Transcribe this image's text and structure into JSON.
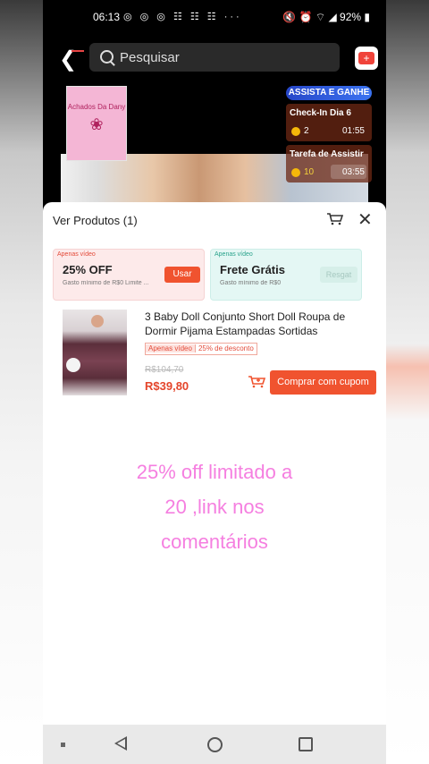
{
  "status_bar": {
    "time": "06:13",
    "notif_icons": "◎ ◎ ◎ ☷ ☷ ☷ ···",
    "right": "🔇 ⏰ ⌔ ◢ 92% ▮"
  },
  "search": {
    "placeholder": "Pesquisar"
  },
  "overlay": {
    "achados_label": "Achados Da Dany",
    "assista_label": "ASSISTA E GANHE",
    "checkin": {
      "label": "Check-In Dia 6",
      "coins": "2",
      "timer": "01:55"
    },
    "tarefa": {
      "label": "Tarefa de Assistir",
      "coins": "10",
      "timer": "03:55"
    }
  },
  "sheet": {
    "title": "Ver Produtos (1)",
    "coupons": [
      {
        "tag": "Apenas vídeo",
        "title": "25% OFF",
        "desc": "Gasto mínimo de R$0 Limite ...",
        "action": "Usar"
      },
      {
        "tag": "Apenas vídeo",
        "title": "Frete Grátis",
        "desc": "Gasto mínimo de R$0",
        "action": "Resgat"
      }
    ],
    "product": {
      "name": "3 Baby Doll Conjunto Short Doll Roupa de Dormir Pijama Estampadas Sortidas",
      "badge_video": "Apenas vídeo",
      "badge_discount": "25% de desconto",
      "old_price": "R$104,70",
      "price": "R$39,80",
      "cta": "Comprar com cupom"
    }
  },
  "caption": {
    "line1": "25% off limitado a",
    "line2": "20 ,link nos",
    "line3": "comentários"
  }
}
